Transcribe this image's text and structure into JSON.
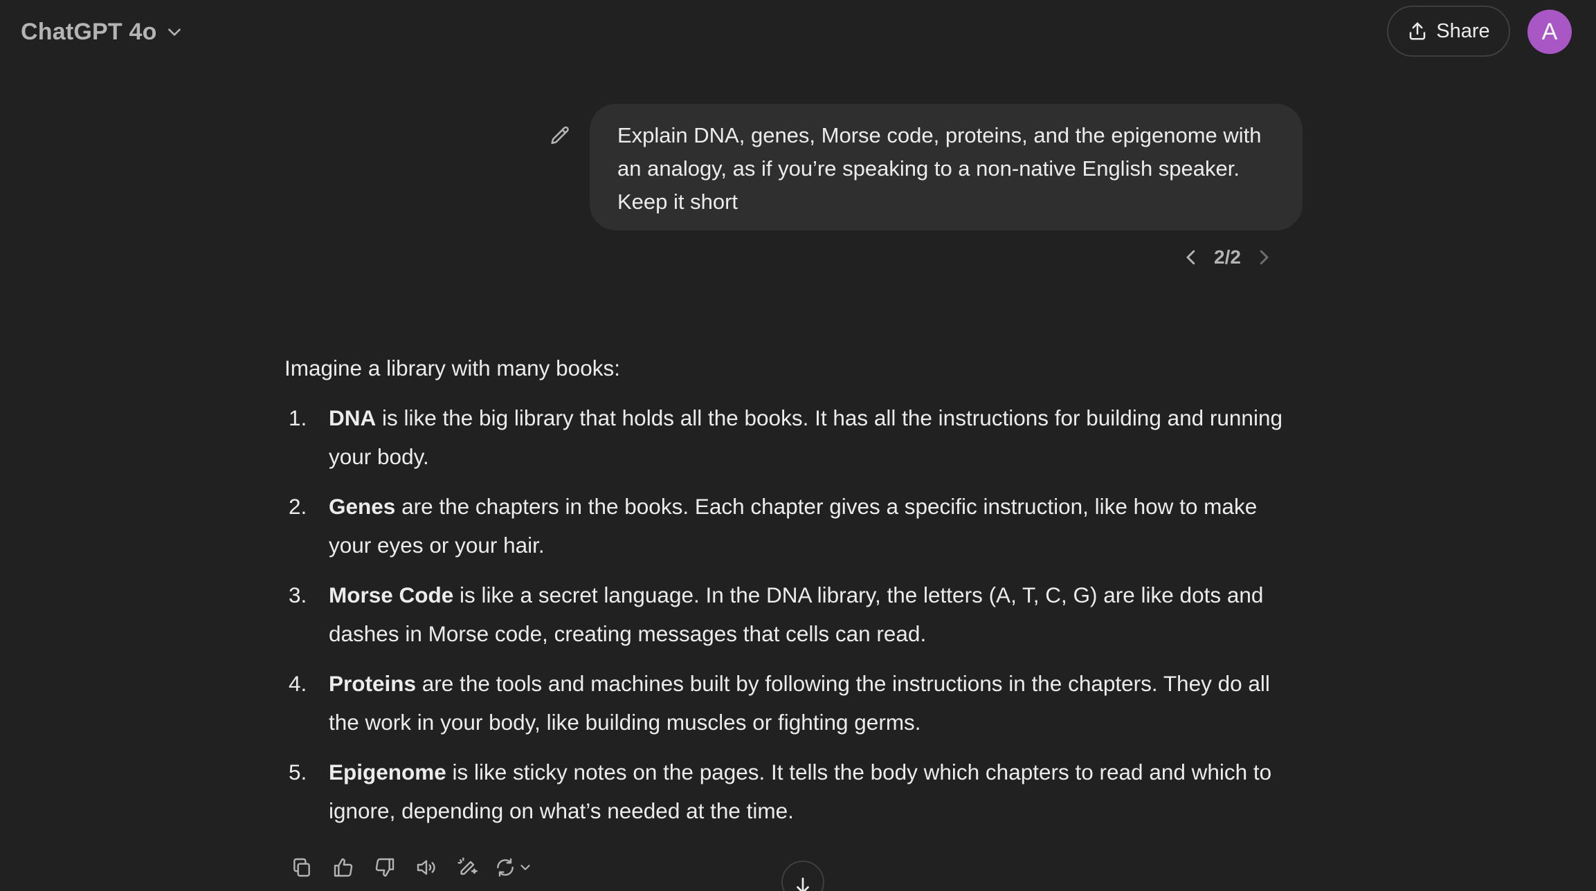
{
  "header": {
    "model_name": "ChatGPT 4o",
    "share_label": "Share",
    "avatar_letter": "A"
  },
  "user_message": {
    "text": "Explain DNA, genes, Morse code, proteins, and the epigenome with an analogy, as if you’re speaking to a non-native English speaker. Keep it short",
    "pager_text": "2/2"
  },
  "assistant_message": {
    "intro": "Imagine a library with many books:",
    "items": [
      {
        "number": "1.",
        "term": "DNA",
        "text": " is like the big library that holds all the books. It has all the instructions for building and running your body."
      },
      {
        "number": "2.",
        "term": "Genes",
        "text": " are the chapters in the books. Each chapter gives a specific instruction, like how to make your eyes or your hair."
      },
      {
        "number": "3.",
        "term": "Morse Code",
        "text": " is like a secret language. In the DNA library, the letters (A, T, C, G) are like dots and dashes in Morse code, creating messages that cells can read."
      },
      {
        "number": "4.",
        "term": "Proteins",
        "text": " are the tools and machines built by following the instructions in the chapters. They do all the work in your body, like building muscles or fighting germs."
      },
      {
        "number": "5.",
        "term": "Epigenome",
        "text": " is like sticky notes on the pages. It tells the body which chapters to read and which to ignore, depending on what’s needed at the time."
      }
    ]
  },
  "actions": [
    "copy-icon",
    "thumbs-up-icon",
    "thumbs-down-icon",
    "read-aloud-icon",
    "edit-canvas-icon",
    "regenerate-icon"
  ],
  "colors": {
    "background": "#212121",
    "bubble": "#2f2f2f",
    "text": "#ececec",
    "muted": "#b4b4b4",
    "avatar": "#a957c4"
  }
}
